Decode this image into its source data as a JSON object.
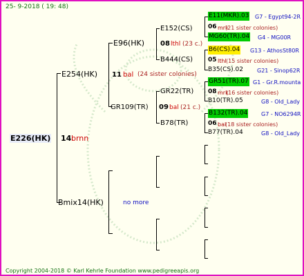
{
  "header": {
    "date": "25-  9-2018 ( 19: 48)"
  },
  "root": {
    "id": "E226(HK)",
    "year": "14",
    "breeder": "brnn"
  },
  "gen1": [
    {
      "id": "E254(HK)",
      "year": "11",
      "breeder": "bal",
      "siblings": "(24 sister colonies)"
    },
    {
      "id": "Bmix14(HK)",
      "info": "no more"
    }
  ],
  "gen2": [
    {
      "id": "E96(HK)",
      "year": "08",
      "breeder": "lthl",
      "siblings": "(23 c.)"
    },
    {
      "id": "GR109(TR)",
      "year": "09",
      "breeder": "bal",
      "siblings": "(21 c.)"
    }
  ],
  "gen3": [
    {
      "id": "E152(CS)"
    },
    {
      "id": "B444(CS)"
    },
    {
      "id": "GR22(TR)"
    },
    {
      "id": "B78(TR)"
    }
  ],
  "gen4": [
    {
      "id": "E11(MKR).03",
      "origin": "G7 - Egypt94-2R"
    },
    {
      "year": "06",
      "breeder": "mrk",
      "siblings": "(21 sister colonies)"
    },
    {
      "id": "MG60(TR).04",
      "origin": "G4 - MG00R"
    },
    {
      "id": "B6(CS).04",
      "origin": "G13 - AthosSt80R"
    },
    {
      "year": "05",
      "breeder": "lthl",
      "siblings": "(15 sister colonies)"
    },
    {
      "id": "B35(CS).02",
      "origin": "G21 - Sinop62R"
    },
    {
      "id": "GR51(TR).07",
      "origin": "G1 - Gr.R.mounta"
    },
    {
      "year": "08",
      "breeder": "mrk",
      "siblings": "(16 sister colonies)"
    },
    {
      "id": "B10(TR).05",
      "origin": "G8 - Old_Lady"
    },
    {
      "id": "B132(TR).04",
      "origin": "G7 - NO6294R"
    },
    {
      "year": "06",
      "breeder": "bal",
      "siblings": "(18 sister colonies)"
    },
    {
      "id": "B77(TR).04",
      "origin": "G8 - Old_Lady"
    }
  ],
  "footer": {
    "copyright": "Copyright 2004-2018 © Karl Kehrle Foundation    www.pedigreeapis.org"
  }
}
